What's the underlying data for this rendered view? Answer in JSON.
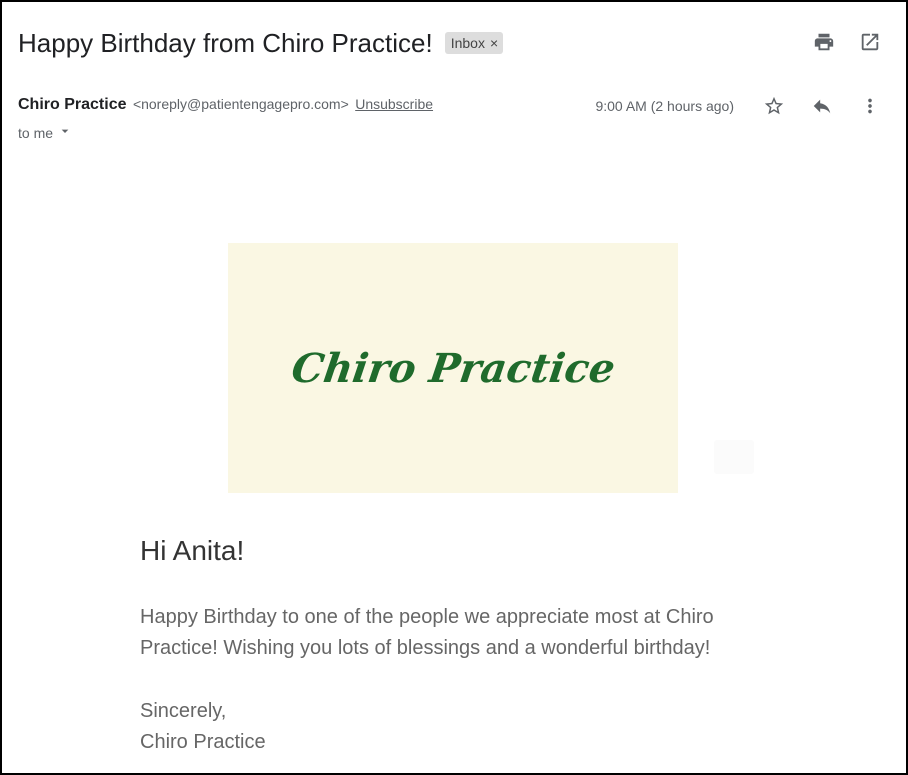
{
  "email": {
    "subject": "Happy Birthday from Chiro Practice!",
    "label": "Inbox",
    "label_remove": "×",
    "sender_name": "Chiro Practice",
    "sender_email": "<noreply@patientengagepro.com>",
    "unsubscribe": "Unsubscribe",
    "time": "9:00 AM (2 hours ago)",
    "to": "to me"
  },
  "icons": {
    "print": "print-icon",
    "open_new_window": "open-in-new-window-icon",
    "star": "star-icon",
    "reply": "reply-icon",
    "more": "more-vertical-icon",
    "to_expand": "caret-down-icon"
  },
  "body": {
    "banner_logo": "Chiro Practice",
    "greeting": "Hi Anita!",
    "message": "Happy Birthday to one of the people we appreciate most at Chiro Practice! Wishing you lots of blessings and a wonderful birthday!",
    "signoff_1": "Sincerely,",
    "signoff_2": "Chiro Practice"
  },
  "colors": {
    "banner_bg": "#faf7e3",
    "logo_green": "#1f6b2c",
    "chip_bg": "#dddddd"
  }
}
